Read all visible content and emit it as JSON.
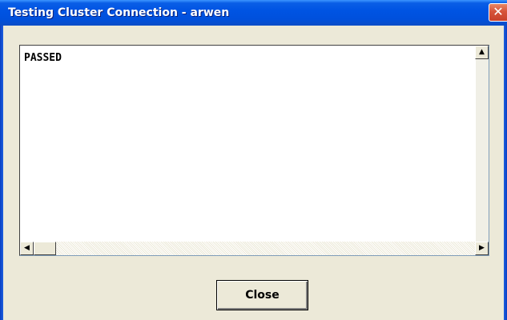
{
  "window": {
    "title": "Testing Cluster Connection - arwen",
    "close_glyph": "✕"
  },
  "output": {
    "text": "PASSED"
  },
  "scrollbars": {
    "up_arrow": "▲",
    "down_arrow": "▼",
    "left_arrow": "◀",
    "right_arrow": "▶"
  },
  "buttons": {
    "close_label": "Close"
  },
  "colors": {
    "titlebar": "#0054e3",
    "window_bg": "#ece9d8",
    "close_x": "#d6533a"
  }
}
